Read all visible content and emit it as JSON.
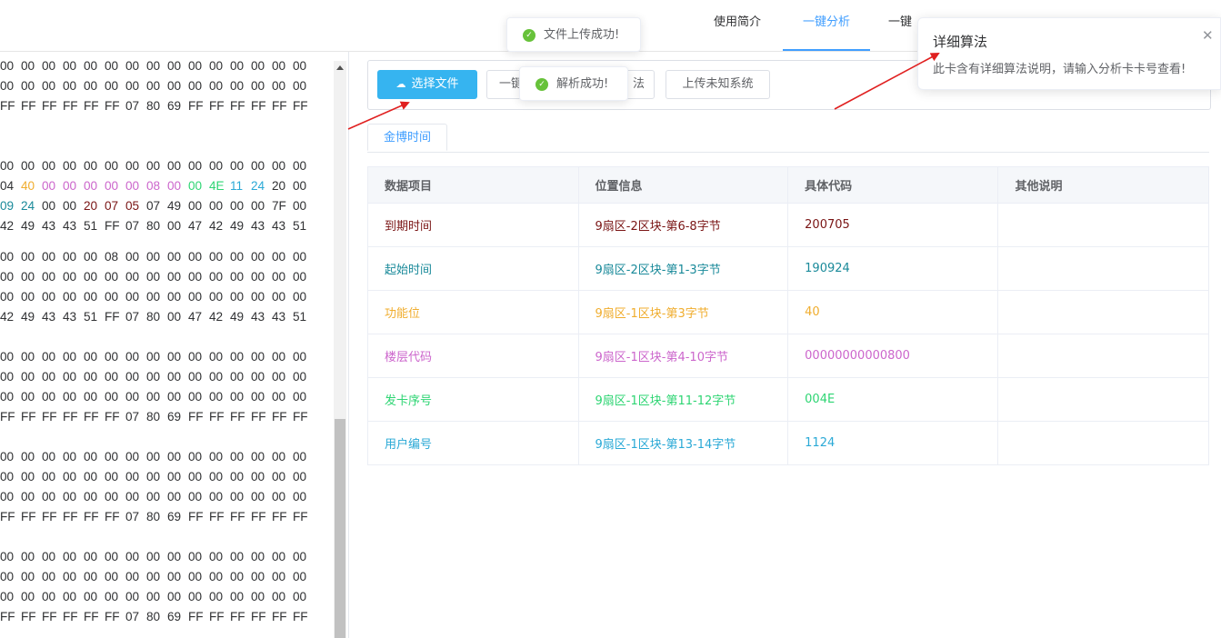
{
  "nav": {
    "items": [
      {
        "label": "使用简介"
      },
      {
        "label": "一键分析"
      },
      {
        "label": "一键"
      }
    ]
  },
  "hex": {
    "groups": [
      [
        [
          "00",
          "00",
          "00",
          "00",
          "00",
          "00",
          "00",
          "00",
          "00",
          "00",
          "00",
          "00",
          "00",
          "00",
          "00"
        ],
        [
          "00",
          "00",
          "00",
          "00",
          "00",
          "00",
          "00",
          "00",
          "00",
          "00",
          "00",
          "00",
          "00",
          "00",
          "00"
        ],
        [
          "FF",
          "FF",
          "FF",
          "FF",
          "FF",
          "FF",
          "07",
          "80",
          "69",
          "FF",
          "FF",
          "FF",
          "FF",
          "FF",
          "FF"
        ]
      ],
      [
        [
          "00",
          "00",
          "00",
          "00",
          "00",
          "00",
          "00",
          "00",
          "00",
          "00",
          "00",
          "00",
          "00",
          "00",
          "00"
        ],
        [
          "04",
          "40",
          "00",
          "00",
          "00",
          "00",
          "00",
          "08",
          "00",
          "00",
          "4E",
          "11",
          "24",
          "20",
          "00"
        ],
        [
          "09",
          "24",
          "00",
          "00",
          "20",
          "07",
          "05",
          "07",
          "49",
          "00",
          "00",
          "00",
          "00",
          "7F",
          "00"
        ],
        [
          "42",
          "49",
          "43",
          "43",
          "51",
          "FF",
          "07",
          "80",
          "00",
          "47",
          "42",
          "49",
          "43",
          "43",
          "51"
        ]
      ],
      [
        [
          "00",
          "00",
          "00",
          "00",
          "00",
          "08",
          "00",
          "00",
          "00",
          "00",
          "00",
          "00",
          "00",
          "00",
          "00"
        ],
        [
          "00",
          "00",
          "00",
          "00",
          "00",
          "00",
          "00",
          "00",
          "00",
          "00",
          "00",
          "00",
          "00",
          "00",
          "00"
        ],
        [
          "00",
          "00",
          "00",
          "00",
          "00",
          "00",
          "00",
          "00",
          "00",
          "00",
          "00",
          "00",
          "00",
          "00",
          "00"
        ],
        [
          "42",
          "49",
          "43",
          "43",
          "51",
          "FF",
          "07",
          "80",
          "00",
          "47",
          "42",
          "49",
          "43",
          "43",
          "51"
        ]
      ],
      [
        [
          "00",
          "00",
          "00",
          "00",
          "00",
          "00",
          "00",
          "00",
          "00",
          "00",
          "00",
          "00",
          "00",
          "00",
          "00"
        ],
        [
          "00",
          "00",
          "00",
          "00",
          "00",
          "00",
          "00",
          "00",
          "00",
          "00",
          "00",
          "00",
          "00",
          "00",
          "00"
        ],
        [
          "00",
          "00",
          "00",
          "00",
          "00",
          "00",
          "00",
          "00",
          "00",
          "00",
          "00",
          "00",
          "00",
          "00",
          "00"
        ],
        [
          "FF",
          "FF",
          "FF",
          "FF",
          "FF",
          "FF",
          "07",
          "80",
          "69",
          "FF",
          "FF",
          "FF",
          "FF",
          "FF",
          "FF"
        ]
      ],
      [
        [
          "00",
          "00",
          "00",
          "00",
          "00",
          "00",
          "00",
          "00",
          "00",
          "00",
          "00",
          "00",
          "00",
          "00",
          "00"
        ],
        [
          "00",
          "00",
          "00",
          "00",
          "00",
          "00",
          "00",
          "00",
          "00",
          "00",
          "00",
          "00",
          "00",
          "00",
          "00"
        ],
        [
          "00",
          "00",
          "00",
          "00",
          "00",
          "00",
          "00",
          "00",
          "00",
          "00",
          "00",
          "00",
          "00",
          "00",
          "00"
        ],
        [
          "FF",
          "FF",
          "FF",
          "FF",
          "FF",
          "FF",
          "07",
          "80",
          "69",
          "FF",
          "FF",
          "FF",
          "FF",
          "FF",
          "FF"
        ]
      ],
      [
        [
          "00",
          "00",
          "00",
          "00",
          "00",
          "00",
          "00",
          "00",
          "00",
          "00",
          "00",
          "00",
          "00",
          "00",
          "00"
        ],
        [
          "00",
          "00",
          "00",
          "00",
          "00",
          "00",
          "00",
          "00",
          "00",
          "00",
          "00",
          "00",
          "00",
          "00",
          "00"
        ],
        [
          "00",
          "00",
          "00",
          "00",
          "00",
          "00",
          "00",
          "00",
          "00",
          "00",
          "00",
          "00",
          "00",
          "00",
          "00"
        ],
        [
          "FF",
          "FF",
          "FF",
          "FF",
          "FF",
          "FF",
          "07",
          "80",
          "69",
          "FF",
          "FF",
          "FF",
          "FF",
          "FF",
          "FF"
        ]
      ]
    ],
    "highlights": {
      "1.1.1": "#f0ad2e",
      "1.1.2": "#cc66cc",
      "1.1.3": "#cc66cc",
      "1.1.4": "#cc66cc",
      "1.1.5": "#cc66cc",
      "1.1.6": "#cc66cc",
      "1.1.7": "#cc66cc",
      "1.1.8": "#cc66cc",
      "1.1.9": "#2ed573",
      "1.1.10": "#2ed573",
      "1.1.11": "#2aa9d6",
      "1.1.12": "#2aa9d6",
      "1.2.0": "#1a8a9a",
      "1.2.1": "#1a8a9a",
      "1.2.4": "#7a1515",
      "1.2.5": "#7a1515",
      "1.2.6": "#7a1515"
    }
  },
  "toolbar": {
    "choose_file": "选择文件",
    "btn2": "一键",
    "btn3": "法",
    "upload_unknown": "上传未知系统"
  },
  "tabs": [
    {
      "label": "金博时间"
    }
  ],
  "table": {
    "headers": [
      "数据项目",
      "位置信息",
      "具体代码",
      "其他说明"
    ],
    "rows": [
      {
        "item": "到期时间",
        "position": "9扇区-2区块-第6-8字节",
        "code": "200705",
        "note": "",
        "color": "#7a1515"
      },
      {
        "item": "起始时间",
        "position": "9扇区-2区块-第1-3字节",
        "code": "190924",
        "note": "",
        "color": "#1a8a9a"
      },
      {
        "item": "功能位",
        "position": "9扇区-1区块-第3字节",
        "code": "40",
        "note": "",
        "color": "#f0ad2e"
      },
      {
        "item": "楼层代码",
        "position": "9扇区-1区块-第4-10字节",
        "code": "00000000000800",
        "note": "",
        "color": "#cc66cc"
      },
      {
        "item": "发卡序号",
        "position": "9扇区-1区块-第11-12字节",
        "code": "004E",
        "note": "",
        "color": "#2ed573"
      },
      {
        "item": "用户编号",
        "position": "9扇区-1区块-第13-14字节",
        "code": "1124",
        "note": "",
        "color": "#2aa9d6"
      }
    ]
  },
  "toasts": {
    "upload": "文件上传成功!",
    "parse": "解析成功!"
  },
  "notify": {
    "title": "详细算法",
    "message": "此卡含有详细算法说明，请输入分析卡卡号查看!"
  }
}
